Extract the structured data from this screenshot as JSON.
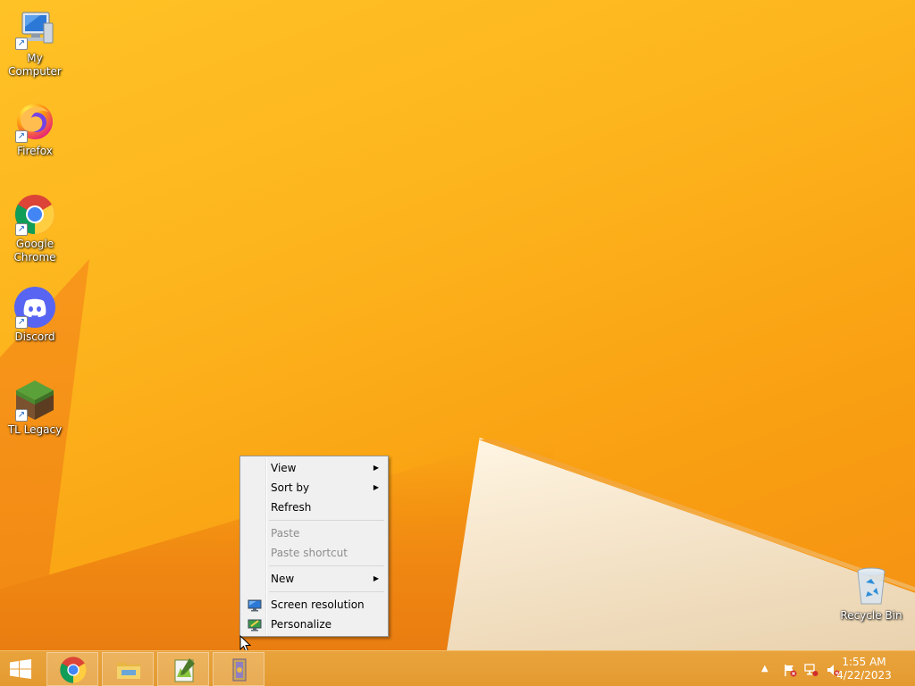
{
  "desktop": {
    "icons": [
      {
        "label": "My Computer",
        "icon": "computer-icon"
      },
      {
        "label": "Firefox",
        "icon": "firefox-icon"
      },
      {
        "label": "Google Chrome",
        "icon": "chrome-icon"
      },
      {
        "label": "Discord",
        "icon": "discord-icon"
      },
      {
        "label": "TL Legacy",
        "icon": "minecraft-grass-block-icon"
      },
      {
        "label": "Recycle Bin",
        "icon": "recycle-bin-icon"
      }
    ]
  },
  "context_menu": {
    "items": [
      {
        "label": "View",
        "submenu": true,
        "enabled": true
      },
      {
        "label": "Sort by",
        "submenu": true,
        "enabled": true
      },
      {
        "label": "Refresh",
        "submenu": false,
        "enabled": true
      },
      {
        "label": "Paste",
        "submenu": false,
        "enabled": false
      },
      {
        "label": "Paste shortcut",
        "submenu": false,
        "enabled": false
      },
      {
        "label": "New",
        "submenu": true,
        "enabled": true
      },
      {
        "label": "Screen resolution",
        "submenu": false,
        "enabled": true,
        "icon": "screen-resolution-icon"
      },
      {
        "label": "Personalize",
        "submenu": false,
        "enabled": true,
        "icon": "personalize-icon"
      }
    ],
    "submenu_arrow": "▶"
  },
  "taskbar": {
    "start_icon": "windows-logo-icon",
    "pinned": [
      {
        "name": "Google Chrome",
        "icon": "chrome-icon"
      },
      {
        "name": "File Explorer",
        "icon": "folder-icon"
      },
      {
        "name": "Notepad++",
        "icon": "notepadpp-icon"
      },
      {
        "name": "Application",
        "icon": "app-icon"
      }
    ],
    "tray": {
      "overflow_glyph": "▲",
      "icons": [
        "action-center-flag-icon",
        "network-icon",
        "volume-muted-icon"
      ]
    },
    "clock": {
      "time": "1:55 AM",
      "date": "4/22/2023"
    }
  },
  "colors": {
    "wallpaper_primary": "#fdb51d",
    "wallpaper_dark": "#f08512",
    "taskbar": "#e49a30",
    "menu_bg": "#f0f0f0"
  }
}
